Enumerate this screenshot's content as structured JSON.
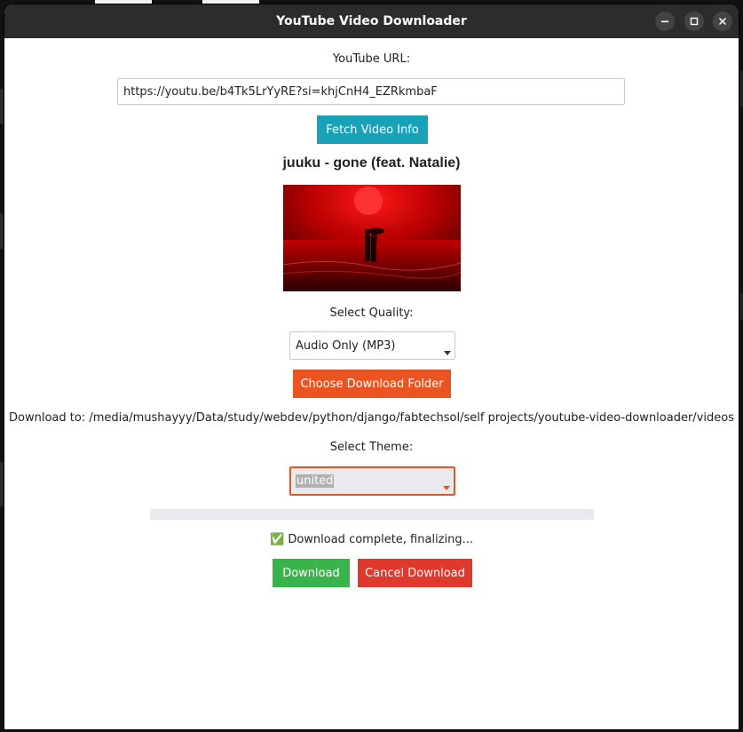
{
  "window": {
    "title": "YouTube Video Downloader"
  },
  "url_section": {
    "label": "YouTube URL:",
    "value": "https://youtu.be/b4Tk5LrYyRE?si=khjCnH4_EZRkmbaF"
  },
  "fetch_button": {
    "label": "Fetch Video Info"
  },
  "video": {
    "title": "juuku - gone (feat. Natalie)"
  },
  "quality": {
    "label": "Select Quality:",
    "selected": "Audio Only (MP3)"
  },
  "folder": {
    "button_label": "Choose Download Folder",
    "download_to": "Download to: /media/mushayyy/Data/study/webdev/python/django/fabtechsol/self projects/youtube-video-downloader/videos"
  },
  "theme": {
    "label": "Select Theme:",
    "selected": "united"
  },
  "progress": {
    "value": 1.0
  },
  "status": {
    "text": "✅ Download complete, finalizing..."
  },
  "actions": {
    "download_label": "Download",
    "cancel_label": "Cancel Download"
  },
  "colors": {
    "fetch": "#17a2b8",
    "folder": "#e95420",
    "download": "#38b44a",
    "cancel": "#df382c",
    "titlebar": "#2c2c2c"
  },
  "icons": {
    "minimize": "minimize-icon",
    "maximize": "maximize-icon",
    "close": "close-icon"
  }
}
